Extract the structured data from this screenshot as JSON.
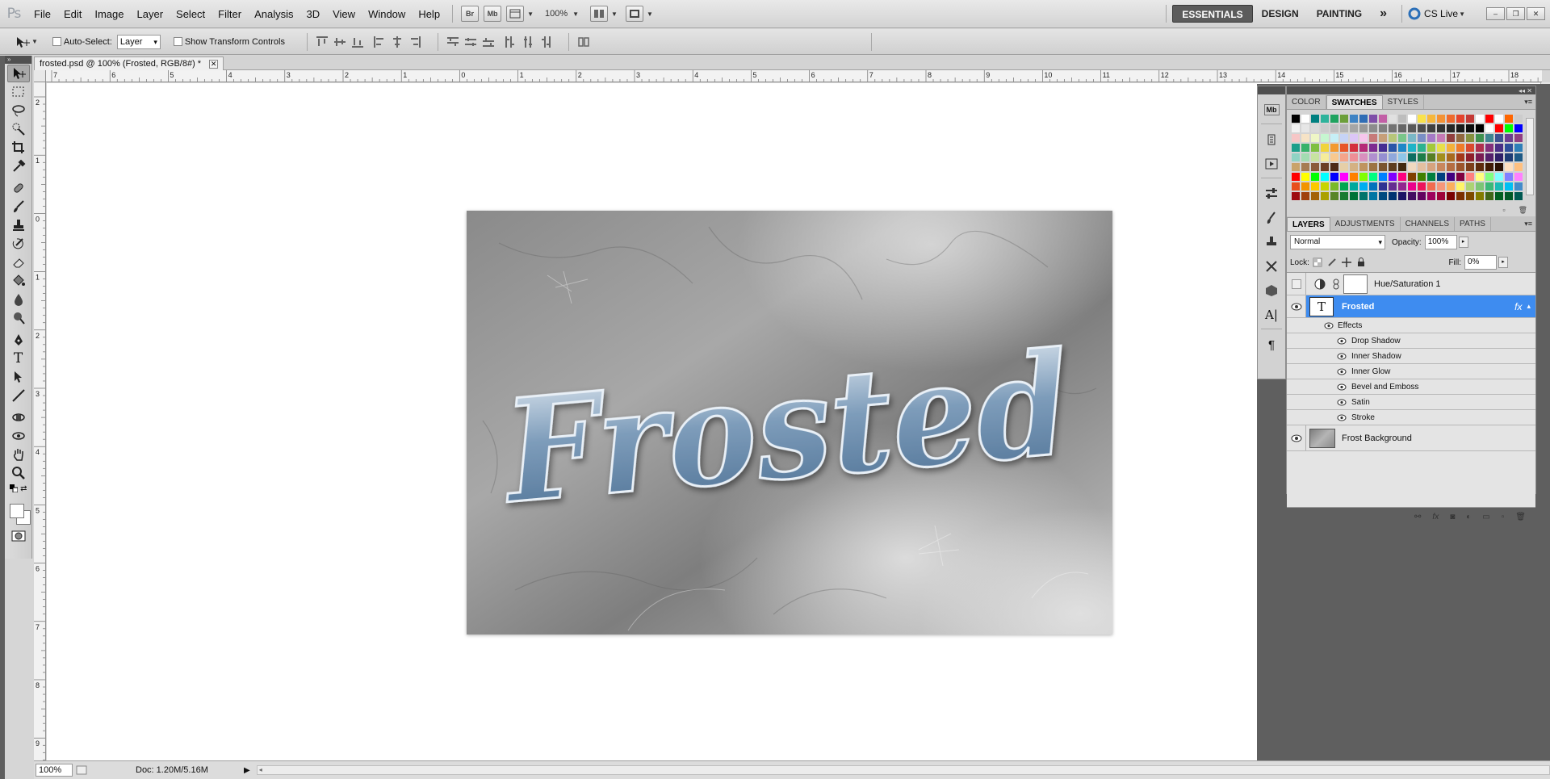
{
  "app": {
    "logo": "Ps",
    "menu": [
      "File",
      "Edit",
      "Image",
      "Layer",
      "Select",
      "Filter",
      "Analysis",
      "3D",
      "View",
      "Window",
      "Help"
    ],
    "bridge_button": "Br",
    "minibridge_button": "Mb",
    "zoom": "100%",
    "workspaces": [
      "ESSENTIALS",
      "DESIGN",
      "PAINTING"
    ],
    "more_workspaces": "»",
    "cs_live": "CS Live"
  },
  "options": {
    "auto_select_label": "Auto-Select:",
    "auto_select_value": "Layer",
    "show_transform_label": "Show Transform Controls"
  },
  "document": {
    "tab_title": "frosted.psd @ 100% (Frosted, RGB/8#) *",
    "ruler_top_labels": [
      "7",
      "6",
      "5",
      "4",
      "3",
      "2",
      "1",
      "0",
      "1",
      "2",
      "3",
      "4",
      "5",
      "6",
      "7",
      "8",
      "9",
      "10",
      "11",
      "12",
      "13",
      "14",
      "15",
      "16",
      "17",
      "18"
    ],
    "ruler_left_labels": [
      "2",
      "1",
      "0",
      "1",
      "2",
      "3",
      "4",
      "5",
      "6",
      "7",
      "8",
      "9"
    ],
    "artwork_text": "Frosted",
    "zoom_field": "100%",
    "doc_info": "Doc: 1.20M/5.16M"
  },
  "swatches_panel": {
    "tabs": [
      "COLOR",
      "SWATCHES",
      "STYLES"
    ],
    "active_tab": "SWATCHES",
    "colors": [
      "#000000",
      "#ffffff",
      "#008080",
      "#2eb39b",
      "#1fa35f",
      "#6c9f3a",
      "#3e83c4",
      "#2f6db5",
      "#7f4fa8",
      "#c25fa6",
      "#e0e0e0",
      "#bdbdbd",
      "#ffffff",
      "#f9e24b",
      "#f6b73c",
      "#f39235",
      "#ee6a2d",
      "#e3432c",
      "#c43a36",
      "#ffffff",
      "#ff0000",
      "#ffffff",
      "#ff6600",
      "#cccccc",
      "#f2f2f2",
      "#e6e6e6",
      "#d9d9d9",
      "#cccccc",
      "#bfbfbf",
      "#b3b3b3",
      "#a6a6a6",
      "#999999",
      "#8c8c8c",
      "#808080",
      "#737373",
      "#666666",
      "#595959",
      "#4d4d4d",
      "#404040",
      "#333333",
      "#262626",
      "#1a1a1a",
      "#0d0d0d",
      "#000000",
      "#ffffff",
      "#ff0000",
      "#00ff00",
      "#0000ff",
      "#f6c6c6",
      "#f6e3c6",
      "#eef6c6",
      "#c6f6d0",
      "#c6eff6",
      "#c6d3f6",
      "#dcc6f6",
      "#f6c6ec",
      "#c67a7a",
      "#c69f7a",
      "#b7c67a",
      "#7ac68a",
      "#7ab7c6",
      "#7a8fc6",
      "#a57ac6",
      "#c67ab5",
      "#913f3f",
      "#91683f",
      "#85913f",
      "#3f9150",
      "#3f8591",
      "#3f5291",
      "#6e3f91",
      "#913f82",
      "#1d9e8a",
      "#38b26a",
      "#7fbf3f",
      "#f0d43a",
      "#f29a31",
      "#e8562a",
      "#d42f3e",
      "#b52a77",
      "#7d2c91",
      "#452e93",
      "#2a56a8",
      "#1f87c7",
      "#1fb3c7",
      "#2db390",
      "#a3c93a",
      "#e8e04a",
      "#f4b13a",
      "#ef7c2a",
      "#d94a2f",
      "#b0304e",
      "#842f7a",
      "#4b2f86",
      "#2f4f9a",
      "#2f7fb8",
      "#8fd3c4",
      "#a3dcb1",
      "#c7e3a0",
      "#f6ec9a",
      "#f8c98f",
      "#f4a48a",
      "#ee8f96",
      "#d98fbe",
      "#b08fcf",
      "#958fd1",
      "#8fa8dc",
      "#8fc6e8",
      "#0f6e61",
      "#1e7d49",
      "#567f25",
      "#a38f1e",
      "#a86a1e",
      "#a3381a",
      "#8f1f2b",
      "#7a1c53",
      "#55206b",
      "#302068",
      "#1e3c74",
      "#1e5a86",
      "#c9a36b",
      "#a67c52",
      "#8a5a3a",
      "#6b3f26",
      "#4d2a18",
      "#e6cfa8",
      "#d4b183",
      "#bf9460",
      "#9c7443",
      "#7a5530",
      "#5e3d1f",
      "#42280f",
      "#f0d9c0",
      "#e3bfa0",
      "#d6a37f",
      "#c9875e",
      "#b56d42",
      "#9c552c",
      "#7d3f1b",
      "#5e2b0e",
      "#401a05",
      "#2b1002",
      "#ffe0c0",
      "#ffc080",
      "#ff0000",
      "#ffff00",
      "#00ff00",
      "#00ffff",
      "#0000ff",
      "#ff00ff",
      "#ff8000",
      "#80ff00",
      "#00ff80",
      "#0080ff",
      "#8000ff",
      "#ff0080",
      "#804000",
      "#408000",
      "#008040",
      "#004080",
      "#400080",
      "#800040",
      "#ff8080",
      "#ffff80",
      "#80ff80",
      "#80ffff",
      "#8080ff",
      "#ff80ff",
      "#e84e1c",
      "#f29400",
      "#fbc900",
      "#c8d400",
      "#7ab929",
      "#00a650",
      "#00a99d",
      "#00aeef",
      "#0072bc",
      "#2e3192",
      "#662d91",
      "#92278f",
      "#ec008c",
      "#ed145b",
      "#f26c4f",
      "#f7977a",
      "#fbaf5d",
      "#fff568",
      "#acd373",
      "#7cc576",
      "#3bb878",
      "#1abbb4",
      "#00bff3",
      "#438ccb",
      "#9e0b0f",
      "#a0410d",
      "#a3620a",
      "#aba000",
      "#598527",
      "#1a7b30",
      "#007236",
      "#00746b",
      "#0076a3",
      "#004b80",
      "#003471",
      "#1b1464",
      "#440e62",
      "#630460",
      "#9e005d",
      "#9e0039",
      "#790000",
      "#7b2e00",
      "#7d4900",
      "#827b00",
      "#406618",
      "#005e20",
      "#005826",
      "#005952"
    ]
  },
  "layers_panel": {
    "tabs": [
      "LAYERS",
      "ADJUSTMENTS",
      "CHANNELS",
      "PATHS"
    ],
    "active_tab": "LAYERS",
    "blend_mode": "Normal",
    "opacity_label": "Opacity:",
    "opacity": "100%",
    "lock_label": "Lock:",
    "fill_label": "Fill:",
    "fill": "0%",
    "layers": {
      "hue_sat": "Hue/Saturation 1",
      "frosted": "Frosted",
      "fx": "fx",
      "effects_label": "Effects",
      "effects": [
        "Drop Shadow",
        "Inner Shadow",
        "Inner Glow",
        "Bevel and Emboss",
        "Satin",
        "Stroke"
      ],
      "background": "Frost Background"
    }
  },
  "colors": {
    "selected_layer": "#3e8cf0",
    "panel_dark": "#5f5f5f",
    "canvas": "#ffffff"
  }
}
